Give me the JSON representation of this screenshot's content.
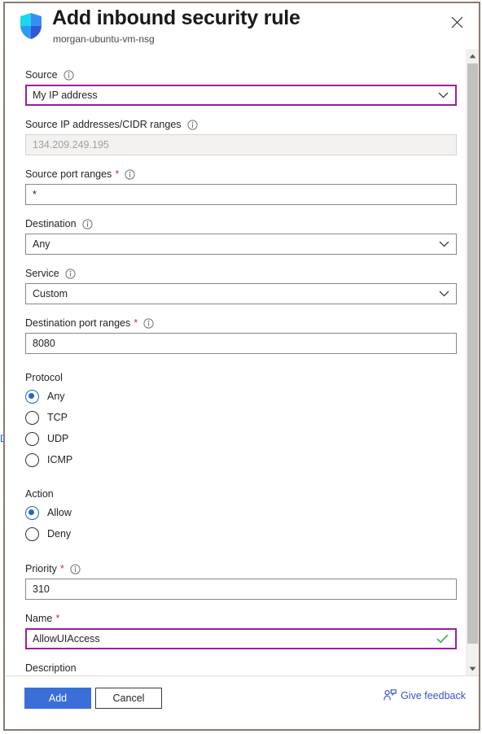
{
  "dialog": {
    "title": "Add inbound security rule",
    "subtitle": "morgan-ubuntu-vm-nsg",
    "shield_icon": "shield-icon",
    "close_icon": "close-icon"
  },
  "colors": {
    "accent_blue": "#3a6fd8",
    "radio_blue": "#2464c8",
    "focus_purple": "#9b1f9b",
    "required_red": "#c4314b",
    "valid_green": "#2aa44a",
    "link_blue": "#3355cc",
    "dialog_border": "#8a7a70"
  },
  "form": {
    "source": {
      "label": "Source",
      "required": false,
      "info_icon": "info-icon",
      "value": "My IP address",
      "focused": true,
      "chevron_icon": "chevron-down-icon"
    },
    "source_ip": {
      "label": "Source IP addresses/CIDR ranges",
      "required": false,
      "info_icon": "info-icon",
      "value": "134.209.249.195",
      "disabled": true
    },
    "source_port": {
      "label": "Source port ranges",
      "required": true,
      "info_icon": "info-icon",
      "value": "*"
    },
    "destination": {
      "label": "Destination",
      "required": false,
      "info_icon": "info-icon",
      "value": "Any",
      "chevron_icon": "chevron-down-icon"
    },
    "service": {
      "label": "Service",
      "required": false,
      "info_icon": "info-icon",
      "value": "Custom",
      "chevron_icon": "chevron-down-icon"
    },
    "dest_port": {
      "label": "Destination port ranges",
      "required": true,
      "info_icon": "info-icon",
      "value": "8080"
    },
    "protocol": {
      "label": "Protocol",
      "selected": "Any",
      "options": [
        "Any",
        "TCP",
        "UDP",
        "ICMP"
      ]
    },
    "action": {
      "label": "Action",
      "selected": "Allow",
      "options": [
        "Allow",
        "Deny"
      ]
    },
    "priority": {
      "label": "Priority",
      "required": true,
      "info_icon": "info-icon",
      "value": "310"
    },
    "name": {
      "label": "Name",
      "required": true,
      "value": "AllowUIAccess",
      "focused": true,
      "valid": true,
      "valid_icon": "checkmark-icon"
    },
    "description": {
      "label": "Description",
      "required": false,
      "value": ""
    }
  },
  "scrollbar": {
    "up_icon": "scroll-up-arrow-icon",
    "down_icon": "scroll-down-arrow-icon"
  },
  "footer": {
    "add_label": "Add",
    "cancel_label": "Cancel",
    "feedback_label": "Give feedback",
    "feedback_icon": "feedback-person-icon"
  }
}
